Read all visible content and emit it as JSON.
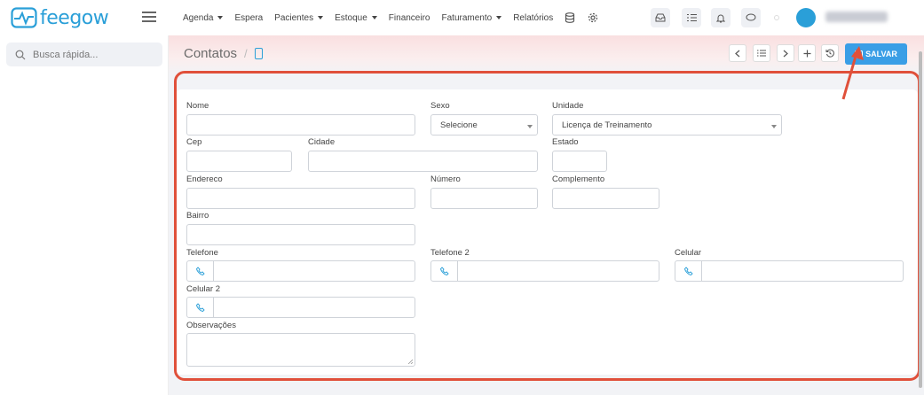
{
  "app": {
    "logo_text": "feegow"
  },
  "nav": {
    "items": [
      {
        "label": "Agenda",
        "dropdown": true
      },
      {
        "label": "Espera",
        "dropdown": false
      },
      {
        "label": "Pacientes",
        "dropdown": true
      },
      {
        "label": "Estoque",
        "dropdown": true
      },
      {
        "label": "Financeiro",
        "dropdown": false
      },
      {
        "label": "Faturamento",
        "dropdown": true
      },
      {
        "label": "Relatórios",
        "dropdown": false
      }
    ]
  },
  "sidebar": {
    "search_placeholder": "Busca rápida..."
  },
  "header": {
    "breadcrumb_title": "Contatos",
    "breadcrumb_sep": "/",
    "save_label": "SALVAR"
  },
  "form": {
    "nome": {
      "label": "Nome",
      "value": ""
    },
    "sexo": {
      "label": "Sexo",
      "value": "Selecione"
    },
    "unidade": {
      "label": "Unidade",
      "value": "Licença de Treinamento"
    },
    "cep": {
      "label": "Cep",
      "value": ""
    },
    "cidade": {
      "label": "Cidade",
      "value": ""
    },
    "estado": {
      "label": "Estado",
      "value": ""
    },
    "endereco": {
      "label": "Endereco",
      "value": ""
    },
    "numero": {
      "label": "Número",
      "value": ""
    },
    "complemento": {
      "label": "Complemento",
      "value": ""
    },
    "bairro": {
      "label": "Bairro",
      "value": ""
    },
    "telefone": {
      "label": "Telefone",
      "value": ""
    },
    "telefone2": {
      "label": "Telefone 2",
      "value": ""
    },
    "celular": {
      "label": "Celular",
      "value": ""
    },
    "celular2": {
      "label": "Celular 2",
      "value": ""
    },
    "observacoes": {
      "label": "Observações",
      "value": ""
    }
  },
  "colors": {
    "accent": "#2a9fd8",
    "save_button": "#3a9ee6",
    "highlight": "#e0503a"
  },
  "icons": [
    "hamburger-icon",
    "database-icon",
    "gear-icon",
    "inbox-icon",
    "tasks-icon",
    "bell-icon",
    "chat-icon",
    "search-icon",
    "phone-icon",
    "chevron-left-icon",
    "list-icon",
    "chevron-right-icon",
    "plus-icon",
    "history-icon",
    "save-icon"
  ]
}
